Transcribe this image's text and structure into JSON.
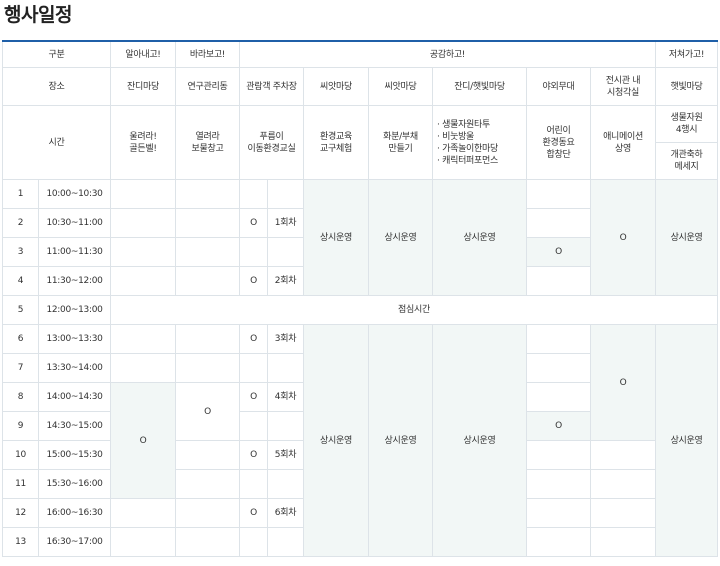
{
  "page_title": "행사일정",
  "categories": {
    "division": "구분",
    "c1": "알아내고!",
    "c2": "바라보고!",
    "c3": "공감하고!",
    "c4": "저쳐가고!"
  },
  "places": {
    "label": "장소",
    "p1": "잔디마당",
    "p2": "연구관리동",
    "p3": "관람객 주차장",
    "p4": "씨앗마당",
    "p5": "씨앗마당",
    "p6": "잔디/햇빛마당",
    "p7": "야외무대",
    "p8": "전시관 내\n시청각실",
    "p9": "햇빛마당"
  },
  "programs": {
    "label": "시간",
    "g1": "울려라!\n골든벨!",
    "g2": "열려라\n보물창고",
    "g3": "푸름이\n이동환경교실",
    "g4": "환경교육\n교구체험",
    "g5": "화분/부채\n만들기",
    "g6": "· 생물자원타투\n· 비눗방울\n· 가족놀이한마당\n· 캐릭터퍼포먼스",
    "g7": "어린이\n환경동요\n합창단",
    "g8": "애니메이션\n상영",
    "g9a": "생물자원\n4행시",
    "g9b": "개관축하\n메세지"
  },
  "rows": [
    {
      "no": "1",
      "time": "10:00~10:30"
    },
    {
      "no": "2",
      "time": "10:30~11:00"
    },
    {
      "no": "3",
      "time": "11:00~11:30"
    },
    {
      "no": "4",
      "time": "11:30~12:00"
    },
    {
      "no": "5",
      "time": "12:00~13:00"
    },
    {
      "no": "6",
      "time": "13:00~13:30"
    },
    {
      "no": "7",
      "time": "13:30~14:00"
    },
    {
      "no": "8",
      "time": "14:00~14:30"
    },
    {
      "no": "9",
      "time": "14:30~15:00"
    },
    {
      "no": "10",
      "time": "15:00~15:30"
    },
    {
      "no": "11",
      "time": "15:30~16:00"
    },
    {
      "no": "12",
      "time": "16:00~16:30"
    },
    {
      "no": "13",
      "time": "16:30~17:00"
    }
  ],
  "marks": {
    "o": "O",
    "always": "상시운영",
    "lunch": "점심시간",
    "r1": "1회차",
    "r2": "2회차",
    "r3": "3회차",
    "r4": "4회차",
    "r5": "5회차",
    "r6": "6회차"
  }
}
